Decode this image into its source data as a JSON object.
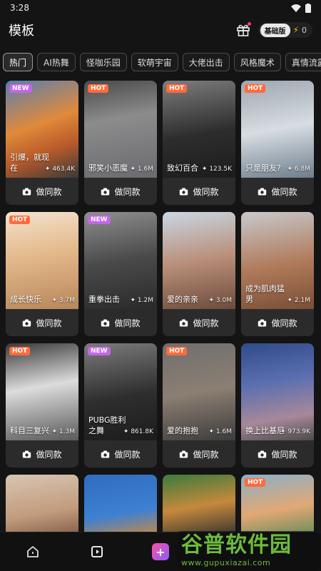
{
  "status": {
    "time": "3:28"
  },
  "header": {
    "title": "模板",
    "plan": "基础版",
    "credits": "0"
  },
  "tabs": [
    {
      "label": "热门",
      "active": true
    },
    {
      "label": "AI热舞"
    },
    {
      "label": "怪咖乐园"
    },
    {
      "label": "软萌宇宙"
    },
    {
      "label": "大佬出击"
    },
    {
      "label": "风格魔术"
    },
    {
      "label": "真情流露"
    }
  ],
  "action_label": "做同款",
  "cards": [
    {
      "tag": "NEW",
      "name": "引爆，就现在",
      "uses": "463.4K"
    },
    {
      "tag": "HOT",
      "name": "邪笑小恶魔",
      "uses": "1.6M"
    },
    {
      "tag": "HOT",
      "name": "致幻百合",
      "uses": "123.5K"
    },
    {
      "tag": "HOT",
      "name": "只是朋友?",
      "uses": "6.8M"
    },
    {
      "tag": "HOT",
      "name": "成长快乐",
      "uses": "3.7M"
    },
    {
      "tag": "NEW",
      "name": "重拳出击",
      "uses": "1.2M"
    },
    {
      "tag": "",
      "name": "爱的亲亲",
      "uses": "3.0M"
    },
    {
      "tag": "",
      "name": "成为肌肉猛男",
      "uses": "2.1M"
    },
    {
      "tag": "HOT",
      "name": "科目三复兴",
      "uses": "1.3M"
    },
    {
      "tag": "NEW",
      "name": "PUBG胜利之舞",
      "uses": "861.8K"
    },
    {
      "tag": "HOT",
      "name": "爱的抱抱",
      "uses": "1.6M"
    },
    {
      "tag": "",
      "name": "换上比基尼",
      "uses": "973.9K"
    },
    {
      "tag": "",
      "name": "",
      "uses": ""
    },
    {
      "tag": "",
      "name": "",
      "uses": ""
    },
    {
      "tag": "",
      "name": "",
      "uses": ""
    },
    {
      "tag": "HOT",
      "name": "",
      "uses": ""
    }
  ],
  "watermark": {
    "cn": "谷普软件园",
    "en": "www.gupuxiazai.com"
  },
  "colors": {
    "hot": "#ff6a3d",
    "new": "#c466e8",
    "accent": "#ff4fa3"
  }
}
